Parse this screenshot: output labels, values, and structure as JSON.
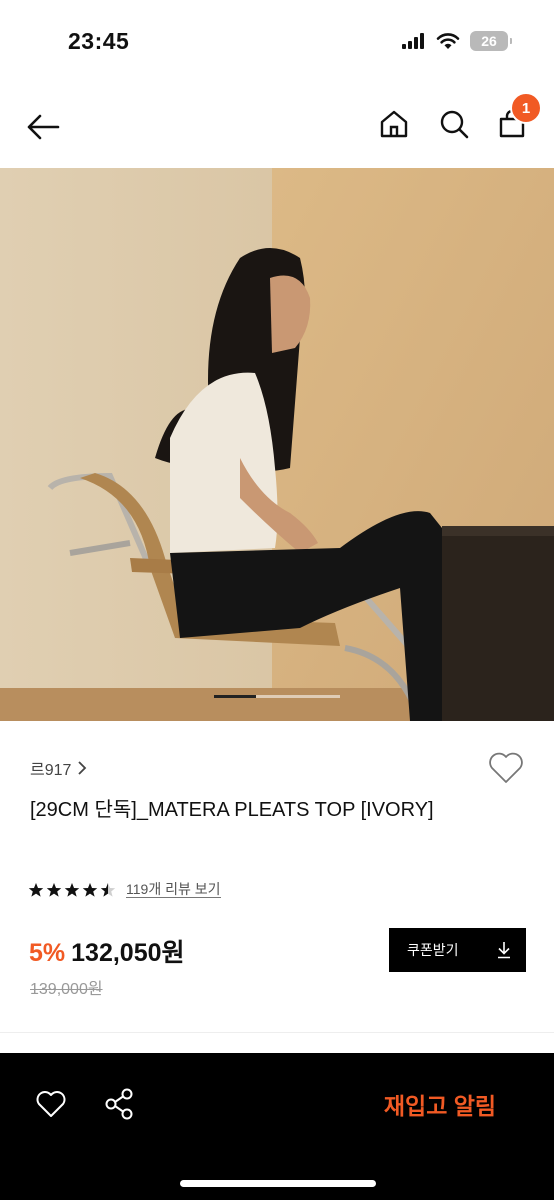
{
  "status_bar": {
    "time": "23:45",
    "battery": "26"
  },
  "header": {
    "cart_count": "1",
    "icons": [
      "back-arrow-icon",
      "home-icon",
      "search-icon",
      "cart-icon"
    ]
  },
  "hero": {
    "slide_progress": 0.33
  },
  "product": {
    "brand": "르917",
    "title": "[29CM 단독]_MATERA PLEATS TOP [IVORY]",
    "rating": 4.5,
    "review_link": "119개 리뷰 보기",
    "discount": "5%",
    "price": "132,050원",
    "original_price": "139,000원",
    "coupon_label": "쿠폰받기"
  },
  "bottom_bar": {
    "restock_label": "재입고 알림"
  },
  "colors": {
    "accent": "#f15a24",
    "dark": "#000000"
  }
}
